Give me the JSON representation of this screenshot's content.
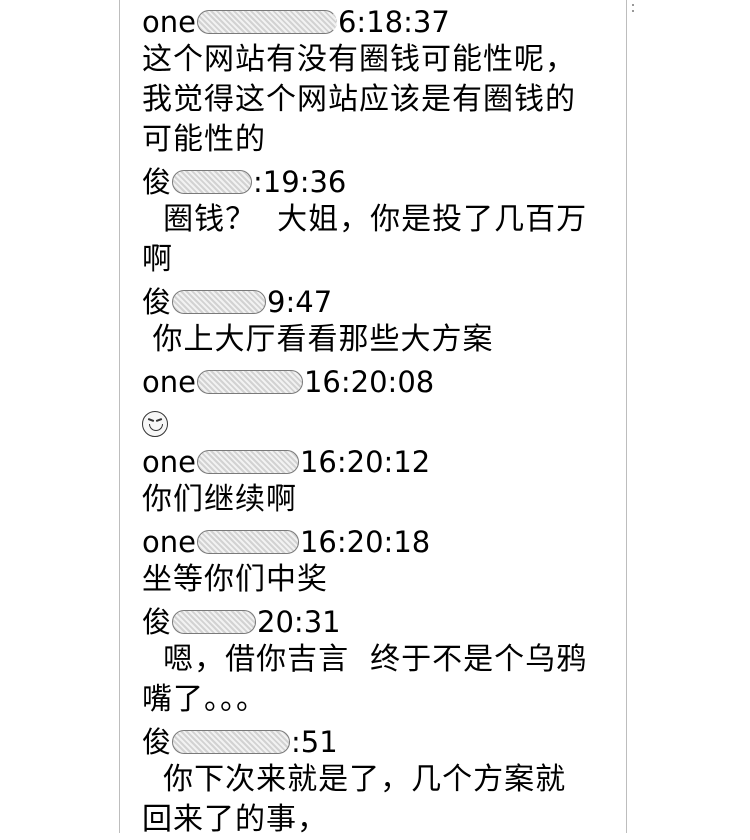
{
  "messages": [
    {
      "name": "one",
      "time": "6:18:37",
      "text": "这个网站有没有圈钱可能性呢，\n我觉得这个网站应该是有圈钱的\n可能性的"
    },
    {
      "name": "俊",
      "time": ":19:36",
      "text": "  圈钱？  大姐，你是投了几百万\n啊"
    },
    {
      "name": "俊",
      "time": "9:47",
      "text": " 你上大厅看看那些大方案"
    },
    {
      "name": "one",
      "time": "16:20:08",
      "emoji": "smile-emoji-icon"
    },
    {
      "name": "one",
      "time": "16:20:12",
      "text": "你们继续啊"
    },
    {
      "name": "one",
      "time": "16:20:18",
      "text": "坐等你们中奖"
    },
    {
      "name": "俊",
      "time": "20:31",
      "text": "  嗯，借你吉言  终于不是个乌鸦\n嘴了。。。"
    },
    {
      "name": "俊",
      "time": ":51",
      "text": "  你下次来就是了，几个方案就\n回来了的事，"
    }
  ]
}
